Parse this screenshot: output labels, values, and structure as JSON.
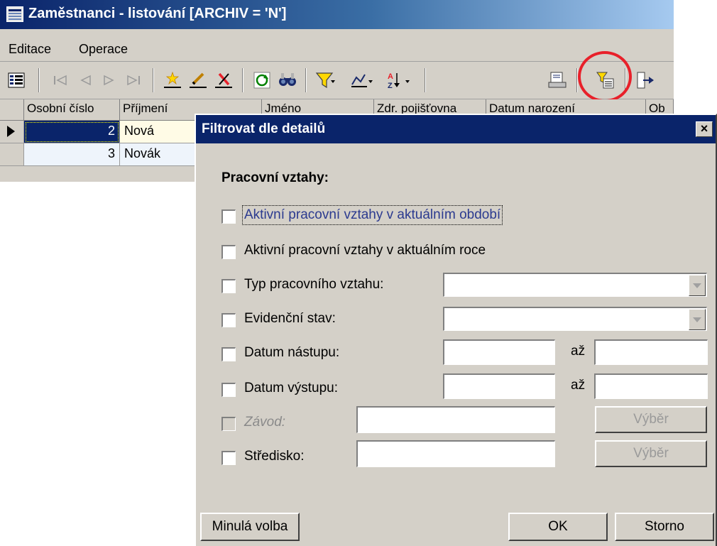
{
  "window": {
    "title": "Zaměstnanci - listování [ARCHIV = 'N']"
  },
  "menu": [
    {
      "label": "Editace"
    },
    {
      "label": "Operace"
    }
  ],
  "toolbar": {
    "icons": [
      "layout-icon",
      "first-record-icon",
      "prev-record-icon",
      "next-record-icon",
      "last-record-icon",
      "new-record-icon",
      "edit-record-icon",
      "delete-record-icon",
      "refresh-icon",
      "find-icon",
      "filter-icon",
      "chart-icon",
      "sort-icon",
      "print-icon",
      "filter-detail-icon",
      "exit-icon"
    ]
  },
  "grid": {
    "columns": [
      "Osobní číslo",
      "Příjmení",
      "Jméno",
      "Zdr. pojišťovna",
      "Datum narození",
      "Ob"
    ],
    "rows": [
      {
        "number": "2",
        "surname": "Nová",
        "selected": true
      },
      {
        "number": "3",
        "surname": "Novák",
        "selected": false
      }
    ]
  },
  "dialog": {
    "title": "Filtrovat dle detailů",
    "close_label": "×",
    "section_title": "Pracovní vztahy:",
    "options": {
      "active_period": "Aktivní pracovní vztahy v aktuálním období",
      "active_year": "Aktivní pracovní vztahy v aktuálním roce",
      "type": "Typ pracovního vztahu:",
      "status": "Evidenční stav:",
      "start_date": "Datum nástupu:",
      "end_date": "Datum výstupu:",
      "plant": "Závod:",
      "center": "Středisko:"
    },
    "range_label": "až",
    "select_button": "Výběr",
    "buttons": {
      "previous": "Minulá volba",
      "ok": "OK",
      "cancel": "Storno"
    }
  },
  "colors": {
    "title_bar": "#0a246a",
    "selected_row": "#0a246a",
    "row_highlight": "#fffbe6",
    "row_alt": "#eef4fb",
    "annotation_circle": "#e8202a"
  }
}
